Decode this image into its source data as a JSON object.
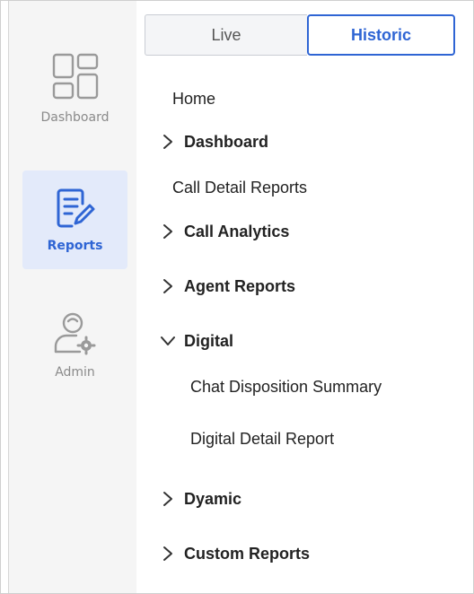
{
  "rail": {
    "items": [
      {
        "label": "Dashboard",
        "icon": "dashboard-grid-icon",
        "active": false
      },
      {
        "label": "Reports",
        "icon": "report-edit-icon",
        "active": true
      },
      {
        "label": "Admin",
        "icon": "admin-user-gear-icon",
        "active": false
      }
    ]
  },
  "tabs": {
    "live_label": "Live",
    "historic_label": "Historic",
    "selected": "Historic"
  },
  "nav": {
    "home": "Home",
    "dashboard": "Dashboard",
    "call_detail_reports": "Call Detail Reports",
    "call_analytics": "Call Analytics",
    "agent_reports": "Agent Reports",
    "digital": "Digital",
    "digital_children": [
      "Chat Disposition Summary",
      "Digital Detail Report"
    ],
    "dyamic": "Dyamic",
    "custom_reports": "Custom Reports"
  },
  "colors": {
    "accent": "#2f65d4",
    "active_bg": "#e3eafa",
    "rail_bg": "#f5f5f5",
    "muted_text": "#8a8a8a"
  }
}
